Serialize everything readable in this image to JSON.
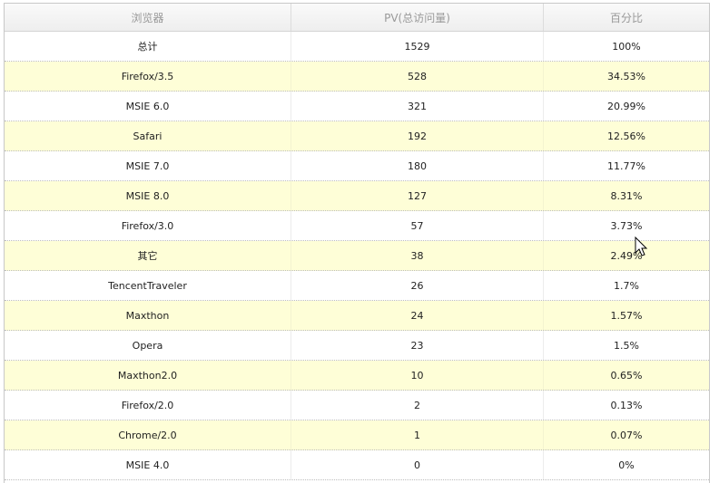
{
  "table": {
    "headers": [
      "浏览器",
      "PV(总访问量)",
      "百分比"
    ],
    "rows": [
      {
        "browser": "总计",
        "pv": "1529",
        "pct": "100%"
      },
      {
        "browser": "Firefox/3.5",
        "pv": "528",
        "pct": "34.53%"
      },
      {
        "browser": "MSIE 6.0",
        "pv": "321",
        "pct": "20.99%"
      },
      {
        "browser": "Safari",
        "pv": "192",
        "pct": "12.56%"
      },
      {
        "browser": "MSIE 7.0",
        "pv": "180",
        "pct": "11.77%"
      },
      {
        "browser": "MSIE 8.0",
        "pv": "127",
        "pct": "8.31%"
      },
      {
        "browser": "Firefox/3.0",
        "pv": "57",
        "pct": "3.73%"
      },
      {
        "browser": "其它",
        "pv": "38",
        "pct": "2.49%"
      },
      {
        "browser": "TencentTraveler",
        "pv": "26",
        "pct": "1.7%"
      },
      {
        "browser": "Maxthon",
        "pv": "24",
        "pct": "1.57%"
      },
      {
        "browser": "Opera",
        "pv": "23",
        "pct": "1.5%"
      },
      {
        "browser": "Maxthon2.0",
        "pv": "10",
        "pct": "0.65%"
      },
      {
        "browser": "Firefox/2.0",
        "pv": "2",
        "pct": "0.13%"
      },
      {
        "browser": "Chrome/2.0",
        "pv": "1",
        "pct": "0.07%"
      },
      {
        "browser": "MSIE 4.0",
        "pv": "0",
        "pct": "0%"
      }
    ]
  },
  "colors": {
    "odd_row": "#fefed7",
    "even_row": "#ffffff",
    "header_text": "#999999"
  },
  "icons": {
    "cursor": "mouse-pointer-icon"
  }
}
